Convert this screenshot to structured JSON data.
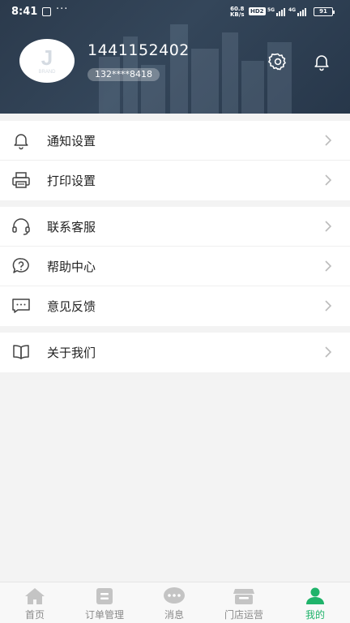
{
  "status_bar": {
    "time": "8:41",
    "dots": "···",
    "speed_value": "60.8",
    "speed_unit": "KB/s",
    "hd_label": "HD2",
    "sig1_label": "5G",
    "sig2_label": "4G",
    "battery": "91"
  },
  "header": {
    "user_name": "1441152402",
    "user_phone": "132****8418",
    "avatar_logo_text": "J",
    "avatar_logo_sub": "BRAND",
    "settings_icon": "gear-icon",
    "bell_icon": "bell-icon",
    "bg_color": "#2b3a4c"
  },
  "menu": {
    "group1": [
      {
        "label": "通知设置",
        "icon": "bell-icon"
      },
      {
        "label": "打印设置",
        "icon": "printer-icon"
      }
    ],
    "group2": [
      {
        "label": "联系客服",
        "icon": "headset-icon"
      },
      {
        "label": "帮助中心",
        "icon": "help-bubble-icon"
      },
      {
        "label": "意见反馈",
        "icon": "chat-dots-icon"
      }
    ],
    "group3": [
      {
        "label": "关于我们",
        "icon": "book-icon"
      }
    ]
  },
  "tabs": [
    {
      "label": "首页",
      "icon": "home-icon"
    },
    {
      "label": "订单管理",
      "icon": "order-icon"
    },
    {
      "label": "消息",
      "icon": "message-icon"
    },
    {
      "label": "门店运营",
      "icon": "store-icon"
    },
    {
      "label": "我的",
      "icon": "profile-icon",
      "active": true
    }
  ],
  "colors": {
    "accent": "#1fb36a",
    "tab_inactive": "#c4c4c4",
    "text": "#222222"
  }
}
